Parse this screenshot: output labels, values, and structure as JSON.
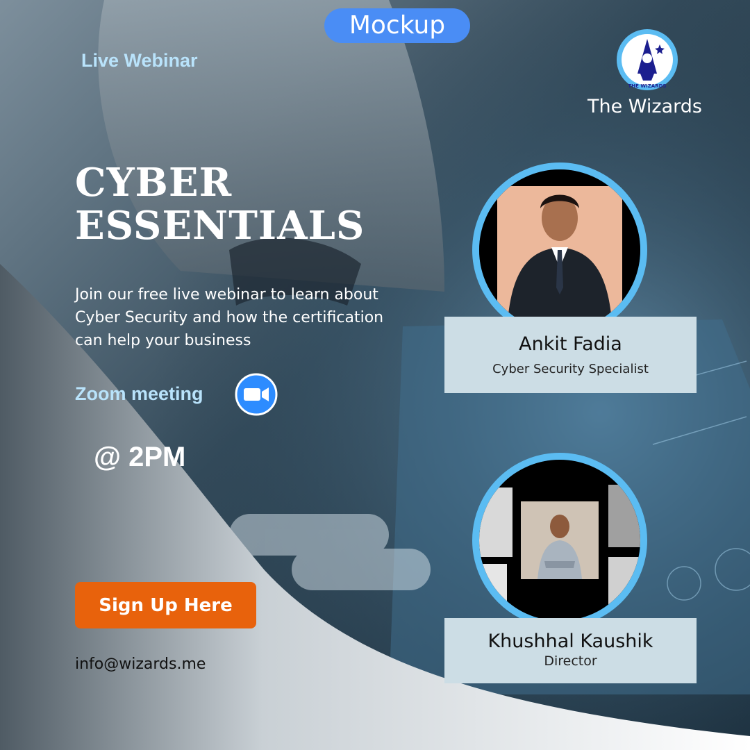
{
  "badge": "Mockup",
  "eyebrow": "Live Webinar",
  "brand": {
    "name": "The Wizards",
    "logo_text": "THE WIZARDS",
    "logo_icon": "wizard-icon"
  },
  "title": {
    "line1": "CYBER",
    "line2": "ESSENTIALS"
  },
  "description": "Join our free live webinar to learn about Cyber Security and how the certification can help your business",
  "meeting": {
    "label": "Zoom meeting",
    "icon": "video-camera-icon"
  },
  "time": "@ 2PM",
  "cta": {
    "label": "Sign Up Here"
  },
  "contact": {
    "email": "info@wizards.me"
  },
  "speakers": [
    {
      "name": "Ankit Fadia",
      "role": "Cyber Security Specialist"
    },
    {
      "name": "Khushhal Kaushik",
      "role": "Director"
    }
  ],
  "colors": {
    "accent_blue": "#4a8df5",
    "ring": "#5bbcf2",
    "cta": "#e8620c",
    "light_text": "#b9e3fb",
    "card": "#ccdde5"
  }
}
